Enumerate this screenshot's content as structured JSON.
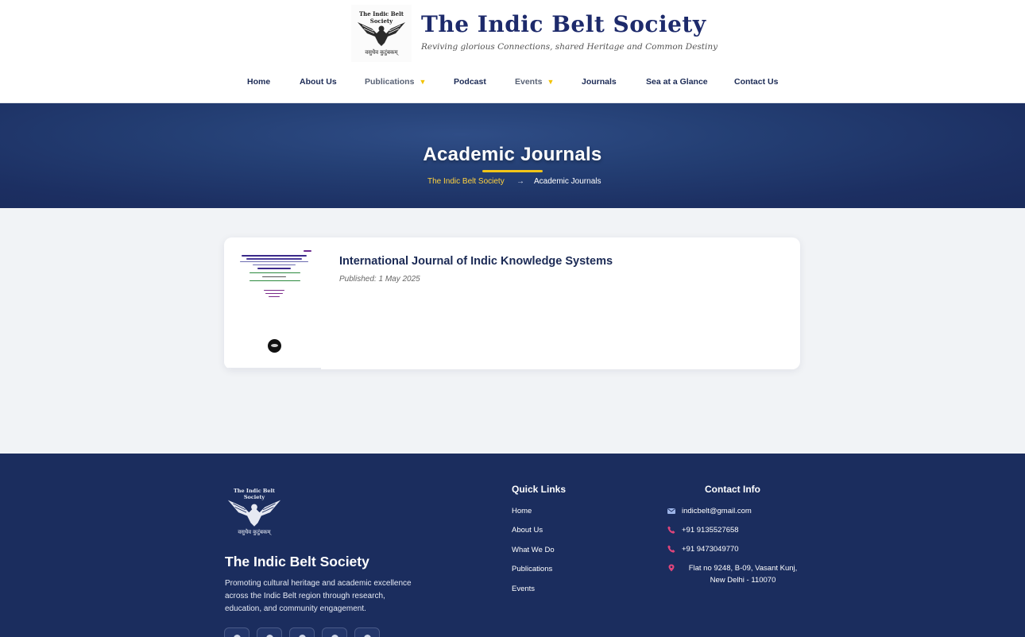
{
  "header": {
    "logo_top_text": "The Indic Belt Society",
    "logo_bottom_text": "वसुधैव कुटुंबकम्",
    "title": "The Indic Belt Society",
    "tagline": "Reviving glorious Connections, shared Heritage and Common Destiny"
  },
  "nav": [
    {
      "label": "Home"
    },
    {
      "label": "About Us"
    },
    {
      "label": "Publications",
      "dropdown": true
    },
    {
      "label": "Podcast"
    },
    {
      "label": "Events",
      "dropdown": true
    },
    {
      "label": "Journals"
    },
    {
      "label": "Sea at a Glance"
    },
    {
      "label": "Contact Us"
    }
  ],
  "hero": {
    "title": "Academic Journals",
    "breadcrumb_home": "The Indic Belt Society",
    "breadcrumb_arrow": "→",
    "breadcrumb_current": "Academic Journals"
  },
  "journal": {
    "title": "International Journal of Indic Knowledge Systems",
    "published": "Published: 1 May 2025"
  },
  "footer": {
    "logo_top_text": "The Indic Belt Society",
    "logo_bottom_text": "वसुधैव कुटुंबकम्",
    "name": "The Indic Belt Society",
    "description": "Promoting cultural heritage and academic excellence across the Indic Belt region through research, education, and community engagement.",
    "socials": [
      "facebook-icon",
      "instagram-icon",
      "youtube-icon",
      "x-icon",
      "linkedin-icon"
    ],
    "quick_links_heading": "Quick Links",
    "quick_links": [
      "Home",
      "About Us",
      "What We Do",
      "Publications",
      "Events"
    ],
    "contact_heading": "Contact Info",
    "email": "indicbelt@gmail.com",
    "phone1": "+91 9135527658",
    "phone2": "+91 9473049770",
    "address": "Flat no 9248, B-09, Vasant Kunj, New Delhi - 110070"
  },
  "colors": {
    "navy": "#1b2d5e",
    "accent_gold": "#f0c419",
    "link_yellow": "#ffd23f",
    "contact_icon_pink": "#e0457b"
  }
}
